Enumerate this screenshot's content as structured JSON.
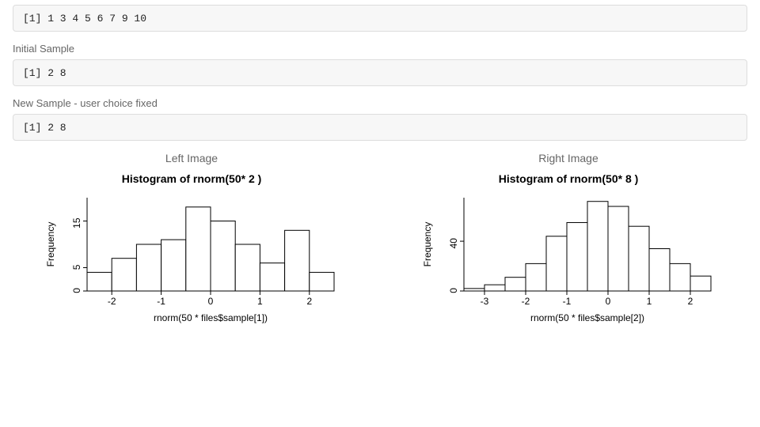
{
  "outputs": {
    "vector": "[1]  1  3  4  5  6  7  9 10",
    "initial_label": "Initial Sample",
    "initial_output": "[1] 2 8",
    "new_label": "New Sample - user choice fixed",
    "new_output": "[1] 2 8"
  },
  "left": {
    "panel_title": "Left Image",
    "chart_title": "Histogram of rnorm(50* 2 )",
    "xlabel": "rnorm(50 * files$sample[1])",
    "ylabel": "Frequency"
  },
  "right": {
    "panel_title": "Right Image",
    "chart_title": "Histogram of rnorm(50* 8 )",
    "xlabel": "rnorm(50 * files$sample[2])",
    "ylabel": "Frequency"
  },
  "chart_data": [
    {
      "id": "left",
      "type": "bar",
      "title": "Histogram of rnorm(50* 2 )",
      "xlabel": "rnorm(50 * files$sample[1])",
      "ylabel": "Frequency",
      "x_ticks": [
        -2,
        -1,
        0,
        1,
        2
      ],
      "y_ticks": [
        0,
        5,
        15
      ],
      "ylim": [
        0,
        20
      ],
      "bin_edges": [
        -2.5,
        -2.0,
        -1.5,
        -1.0,
        -0.5,
        0.0,
        0.5,
        1.0,
        1.5,
        2.0,
        2.5
      ],
      "values": [
        4,
        7,
        10,
        11,
        18,
        15,
        10,
        6,
        13,
        4
      ]
    },
    {
      "id": "right",
      "type": "bar",
      "title": "Histogram of rnorm(50* 8 )",
      "xlabel": "rnorm(50 * files$sample[2])",
      "ylabel": "Frequency",
      "x_ticks": [
        -3,
        -2,
        -1,
        0,
        1,
        2
      ],
      "y_ticks": [
        0,
        40
      ],
      "ylim": [
        0,
        75
      ],
      "bin_edges": [
        -3.5,
        -3.0,
        -2.5,
        -2.0,
        -1.5,
        -1.0,
        -0.5,
        0.0,
        0.5,
        1.0,
        1.5,
        2.0,
        2.5
      ],
      "values": [
        2,
        5,
        11,
        22,
        44,
        55,
        72,
        68,
        52,
        34,
        22,
        12
      ]
    }
  ]
}
